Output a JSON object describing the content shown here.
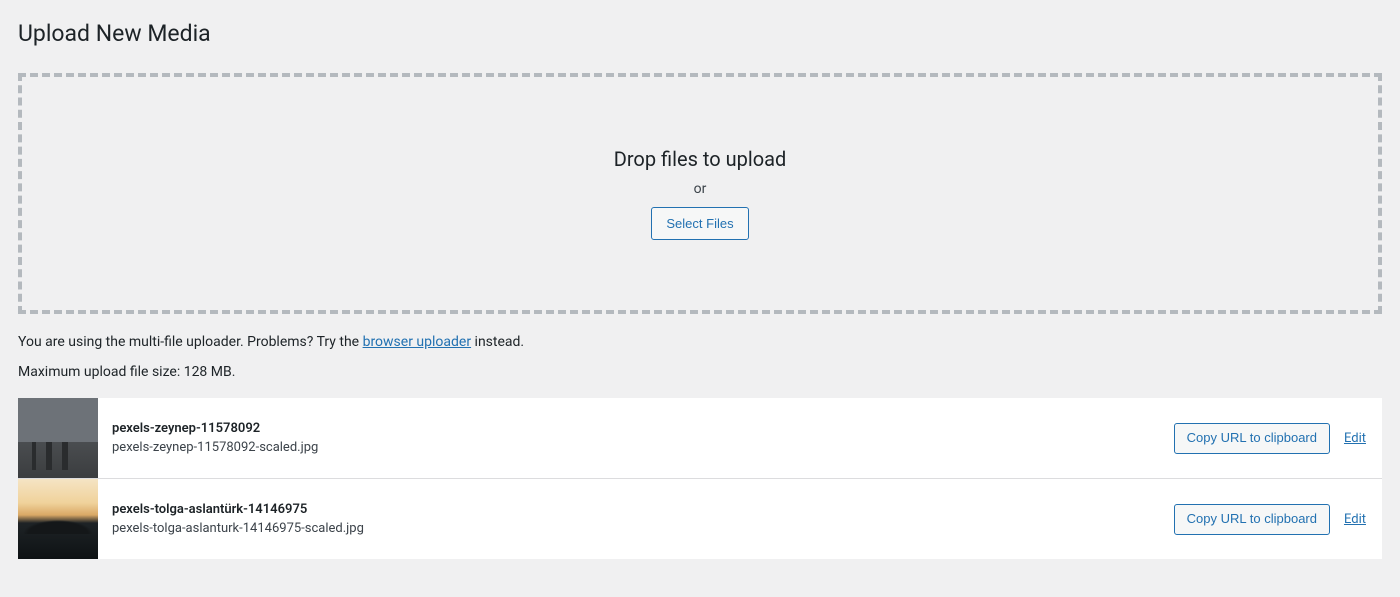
{
  "page": {
    "title": "Upload New Media"
  },
  "dropzone": {
    "title": "Drop files to upload",
    "or": "or",
    "select_button": "Select Files"
  },
  "uploader_info": {
    "prefix": "You are using the multi-file uploader. Problems? Try the ",
    "link_text": "browser uploader",
    "suffix": " instead."
  },
  "max_size": "Maximum upload file size: 128 MB.",
  "actions": {
    "copy_url": "Copy URL to clipboard",
    "edit": "Edit"
  },
  "media": [
    {
      "title": "pexels-zeynep-11578092",
      "filename": "pexels-zeynep-11578092-scaled.jpg"
    },
    {
      "title": "pexels-tolga-aslantürk-14146975",
      "filename": "pexels-tolga-aslanturk-14146975-scaled.jpg"
    }
  ]
}
